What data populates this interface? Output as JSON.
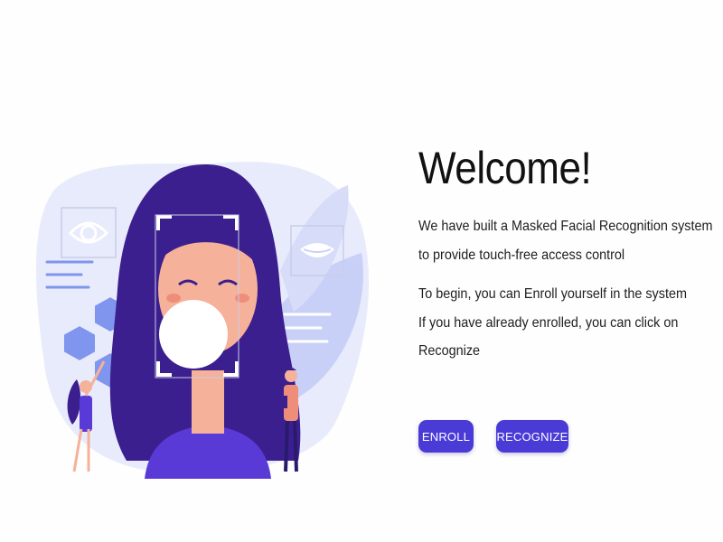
{
  "content": {
    "title": "Welcome!",
    "intro_lines": [
      "We have built a Masked Facial Recognition system",
      "to provide touch-free access control"
    ],
    "instruction_lines": [
      "To begin, you can Enroll yourself in the system",
      "If you have already enrolled, you can click on",
      "Recognize"
    ]
  },
  "actions": {
    "enroll_label": "ENROLL",
    "recognize_label": "RECOGNIZE"
  },
  "colors": {
    "accent": "#4a3bd7",
    "hair": "#3c1f8f",
    "blob": "#e8ebfb",
    "hexagon": "#7f95ee",
    "skin": "#f5b199"
  },
  "illustration": {
    "icons": [
      "eye-icon",
      "lips-icon",
      "face-scan-frame-icon"
    ]
  }
}
